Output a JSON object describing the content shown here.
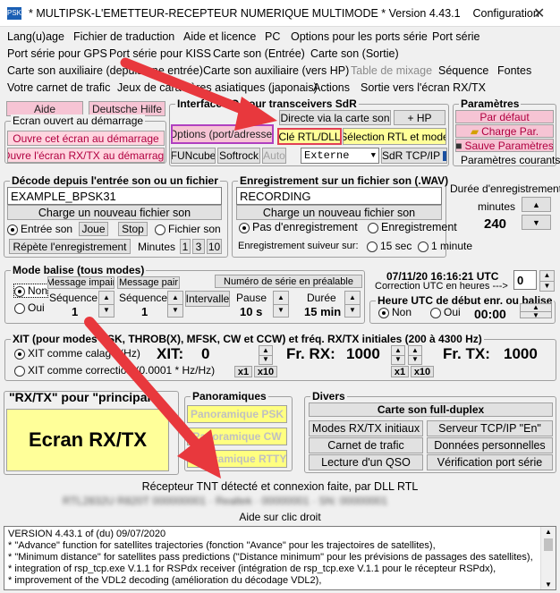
{
  "window": {
    "title": "* MULTIPSK-L'EMETTEUR-RECEPTEUR NUMERIQUE MULTIMODE * Version 4.43.1",
    "tab": "Configuration",
    "close": "✕"
  },
  "menus": [
    [
      "Lang(u)age",
      "Fichier de traduction",
      "Aide et licence",
      "PC",
      "Options pour les ports série",
      "Port série"
    ],
    [
      "Port série pour GPS",
      "Port série pour KISS",
      "Carte son (Entrée)",
      "Carte son (Sortie)"
    ],
    [
      "Carte son auxiliaire (depuis une entrée)",
      "Carte son auxiliaire (vers HP)",
      "Table de mixage",
      "Séquence",
      "Fontes"
    ],
    [
      "Votre carnet de trafic",
      "Jeux de caractères asiatiques (japonais)",
      "Actions",
      "Sortie vers l'écran RX/TX"
    ]
  ],
  "top": {
    "aide": "Aide",
    "deutsche": "Deutsche Hilfe",
    "ecran_ouvert_title": "Ecran ouvert au démarrage",
    "ouvre_cet_ecran": "Ouvre cet écran au démarrage",
    "ouvre_rxtx": "Ouvre l'écran RX/TX au démarrage",
    "interface_title": "Interface I/Q pour transceivers SdR",
    "directe": "Directe via la carte son",
    "plus_hp": "+ HP",
    "options_port": "Options (port/adresse)",
    "cle_rtl": "Clé RTL/DLL",
    "selection_rtl": "Sélection RTL et mode",
    "funcube": "FUNcube",
    "softrock": "Softrock",
    "auto": "Auto",
    "externe": "Externe",
    "sdr_tcpip": "SdR TCP/IP",
    "parametres_title": "Paramètres",
    "par_defaut": "Par défaut",
    "charge_par": "Charge Par.",
    "sauve_param": "Sauve Paramètres",
    "param_courants": "Paramètres courants"
  },
  "decode": {
    "title": "Décode depuis l'entrée son ou un fichier",
    "file_value": "EXAMPLE_BPSK31",
    "charge_btn": "Charge un nouveau fichier son",
    "entree_son": "Entrée son",
    "joue": "Joue",
    "stop": "Stop",
    "fichier_son": "Fichier son",
    "repete": "Répète l'enregistrement",
    "minutes": "Minutes",
    "m1": "1",
    "m3": "3",
    "m10": "10"
  },
  "enreg": {
    "title": "Enregistrement sur un fichier son (.WAV)",
    "file_value": "RECORDING",
    "charge_btn": "Charge un nouveau fichier son",
    "pas_enreg": "Pas d'enregistrement",
    "enregistrement": "Enregistrement",
    "suiveur": "Enregistrement suiveur sur:",
    "sec15": "15 sec",
    "min1": "1 minute",
    "duree_title": "Durée d'enregistrement",
    "minutes": "minutes",
    "duree_value": "240"
  },
  "balise": {
    "title": "Mode balise (tous modes)",
    "non": "Non",
    "oui": "Oui",
    "msg_impair": "Message impair",
    "msg_pair": "Message pair",
    "sequence1": "Séquence",
    "sequence2": "Séquence",
    "seq1_val": "1",
    "seq2_val": "1",
    "intervalle": "Intervalle",
    "numero_serie": "Numéro de série en préalable",
    "pause": "Pause",
    "pause_val": "10 s",
    "duree": "Durée",
    "duree_val": "15 min"
  },
  "utc": {
    "datetime": "07/11/20 16:16:21 UTC",
    "correction": "Correction UTC en heures --->",
    "correction_val": "0",
    "heure_title": "Heure UTC de début enr. ou balise",
    "non": "Non",
    "oui": "Oui",
    "time_val": "00:00"
  },
  "xit": {
    "title": "XIT (pour modes PSK, THROB(X), MFSK, CW et CCW) et fréq. RX/TX initiales (200 à 4300 Hz)",
    "xit_calage": "XIT comme calage (Hz)",
    "xit_correction": "XIT comme correction (0.0001 * Hz/Hz)",
    "xit_label": "XIT:",
    "xit_val": "0",
    "fr_rx": "Fr. RX:",
    "fr_rx_val": "1000",
    "fr_tx": "Fr. TX:",
    "fr_tx_val": "1000",
    "x1": "x1",
    "x10": "x10"
  },
  "rxtx": {
    "title": "\"RX/TX\" pour \"principal\"",
    "ecran": "Ecran RX/TX"
  },
  "pano": {
    "title": "Panoramiques",
    "psk": "Panoramique PSK",
    "cw": "Panoramique CW",
    "rtty": "Panoramique RTTY"
  },
  "divers": {
    "title": "Divers",
    "full_duplex": "Carte son full-duplex",
    "modes_rx_tx": "Modes RX/TX initiaux",
    "serveur": "Serveur TCP/IP \"En\"",
    "carnet": "Carnet de trafic",
    "donnees": "Données personnelles",
    "lecture": "Lecture d'un QSO",
    "verif": "Vérification port série"
  },
  "status": {
    "tnt": "Récepteur TNT détecté et connexion faite, par DLL RTL",
    "blurred": "RTL2832U R820T 000000001 · Realtek · 00000001 · SN: 00000001",
    "aide_clic": "Aide sur clic droit"
  },
  "log": [
    "VERSION 4.43.1 of (du) 09/07/2020",
    "* \"Advance\" function for satellites trajectories (fonction \"Avance\" pour les trajectoires de satellites),",
    "* \"Minimum distance\" for satellites pass predictions (\"Distance minimum\" pour les prévisions de passages des satellites),",
    "* integration of rsp_tcp.exe V.1.1 for RSPdx receiver (intégration de rsp_tcp.exe V.1.1 pour le récepteur RSPdx),",
    "* improvement of the VDL2 decoding (amélioration du décodage VDL2),"
  ],
  "colors": {
    "arrow": "#e8383d",
    "rose": "#f6c4d4",
    "yellow": "#ffff99",
    "magenta": "#ff00ff"
  }
}
